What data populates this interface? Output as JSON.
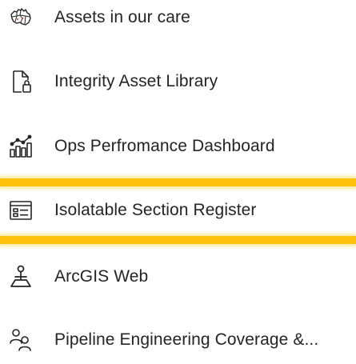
{
  "menu": {
    "items": [
      {
        "label": "Assets in our care",
        "icon": "australia-map-icon"
      },
      {
        "label": "Integrity Asset Library",
        "icon": "document-lock-icon"
      },
      {
        "label": "Ops Perfromance Dashboard",
        "icon": "bar-chart-trend-icon"
      },
      {
        "label": "Isolatable Section Register",
        "icon": "form-list-icon"
      },
      {
        "label": "ArcGIS Web",
        "icon": "map-pin-location-icon"
      },
      {
        "label": "Pipeline Engineering Coverage &...",
        "icon": "people-team-icon"
      }
    ],
    "selected_index": 3
  },
  "colors": {
    "highlight": "#FFC20E",
    "text": "#252423",
    "icon": "#252423"
  }
}
